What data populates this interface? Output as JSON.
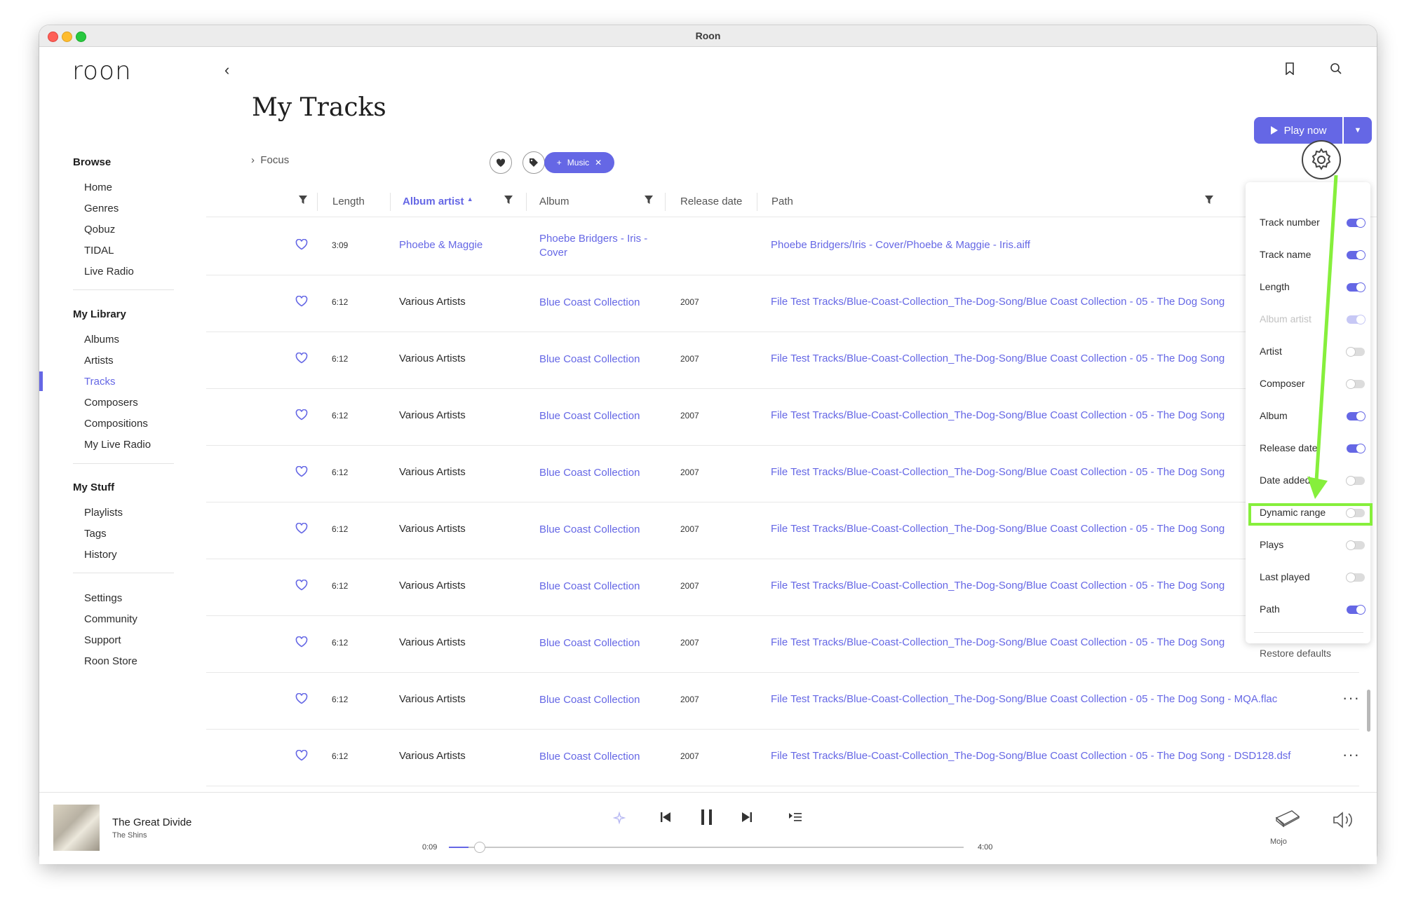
{
  "window": {
    "title": "Roon"
  },
  "sidebar": {
    "logo": "roon",
    "browse": {
      "heading": "Browse",
      "items": [
        "Home",
        "Genres",
        "Qobuz",
        "TIDAL",
        "Live Radio"
      ]
    },
    "library": {
      "heading": "My Library",
      "items": [
        "Albums",
        "Artists",
        "Tracks",
        "Composers",
        "Compositions",
        "My Live Radio"
      ],
      "active": "Tracks"
    },
    "stuff": {
      "heading": "My Stuff",
      "items": [
        "Playlists",
        "Tags",
        "History"
      ]
    },
    "other": {
      "items": [
        "Settings",
        "Community",
        "Support",
        "Roon Store"
      ]
    }
  },
  "header": {
    "page_title": "My Tracks",
    "play_now": "Play now",
    "focus_label": "Focus",
    "music_chip": "Music"
  },
  "columns": {
    "length": "Length",
    "album_artist": "Album artist",
    "album": "Album",
    "release_date": "Release date",
    "path": "Path"
  },
  "rows": [
    {
      "length": "3:09",
      "album_artist": "Phoebe & Maggie",
      "album": "Phoebe Bridgers - Iris - Cover",
      "release_date": "",
      "path": "Phoebe Bridgers/Iris - Cover/Phoebe & Maggie - Iris.aiff"
    },
    {
      "length": "6:12",
      "album_artist": "Various Artists",
      "album": "Blue Coast Collection",
      "release_date": "2007",
      "path": "File Test Tracks/Blue-Coast-Collection_The-Dog-Song/Blue Coast Collection - 05 - The Dog Song"
    },
    {
      "length": "6:12",
      "album_artist": "Various Artists",
      "album": "Blue Coast Collection",
      "release_date": "2007",
      "path": "File Test Tracks/Blue-Coast-Collection_The-Dog-Song/Blue Coast Collection - 05 - The Dog Song"
    },
    {
      "length": "6:12",
      "album_artist": "Various Artists",
      "album": "Blue Coast Collection",
      "release_date": "2007",
      "path": "File Test Tracks/Blue-Coast-Collection_The-Dog-Song/Blue Coast Collection - 05 - The Dog Song"
    },
    {
      "length": "6:12",
      "album_artist": "Various Artists",
      "album": "Blue Coast Collection",
      "release_date": "2007",
      "path": "File Test Tracks/Blue-Coast-Collection_The-Dog-Song/Blue Coast Collection - 05 - The Dog Song"
    },
    {
      "length": "6:12",
      "album_artist": "Various Artists",
      "album": "Blue Coast Collection",
      "release_date": "2007",
      "path": "File Test Tracks/Blue-Coast-Collection_The-Dog-Song/Blue Coast Collection - 05 - The Dog Song"
    },
    {
      "length": "6:12",
      "album_artist": "Various Artists",
      "album": "Blue Coast Collection",
      "release_date": "2007",
      "path": "File Test Tracks/Blue-Coast-Collection_The-Dog-Song/Blue Coast Collection - 05 - The Dog Song"
    },
    {
      "length": "6:12",
      "album_artist": "Various Artists",
      "album": "Blue Coast Collection",
      "release_date": "2007",
      "path": "File Test Tracks/Blue-Coast-Collection_The-Dog-Song/Blue Coast Collection - 05 - The Dog Song"
    },
    {
      "length": "6:12",
      "album_artist": "Various Artists",
      "album": "Blue Coast Collection",
      "release_date": "2007",
      "path": "File Test Tracks/Blue-Coast-Collection_The-Dog-Song/Blue Coast Collection - 05 - The Dog Song - MQA.flac"
    },
    {
      "length": "6:12",
      "album_artist": "Various Artists",
      "album": "Blue Coast Collection",
      "release_date": "2007",
      "path": "File Test Tracks/Blue-Coast-Collection_The-Dog-Song/Blue Coast Collection - 05 - The Dog Song - DSD128.dsf"
    }
  ],
  "column_panel": {
    "items": [
      {
        "label": "Track number",
        "state": "on"
      },
      {
        "label": "Track name",
        "state": "on"
      },
      {
        "label": "Length",
        "state": "on"
      },
      {
        "label": "Album artist",
        "state": "disabled"
      },
      {
        "label": "Artist",
        "state": "off"
      },
      {
        "label": "Composer",
        "state": "off"
      },
      {
        "label": "Album",
        "state": "on"
      },
      {
        "label": "Release date",
        "state": "on"
      },
      {
        "label": "Date added",
        "state": "off"
      },
      {
        "label": "Dynamic range",
        "state": "off"
      },
      {
        "label": "Plays",
        "state": "off"
      },
      {
        "label": "Last played",
        "state": "off"
      },
      {
        "label": "Path",
        "state": "on"
      }
    ],
    "restore": "Restore defaults",
    "highlighted": "Dynamic range"
  },
  "player": {
    "title": "The Great Divide",
    "artist": "The Shins",
    "elapsed": "0:09",
    "duration": "4:00",
    "progress": 0.0375,
    "zone": "Mojo"
  },
  "colors": {
    "accent": "#6567e5",
    "annotation": "#86ef3c"
  }
}
